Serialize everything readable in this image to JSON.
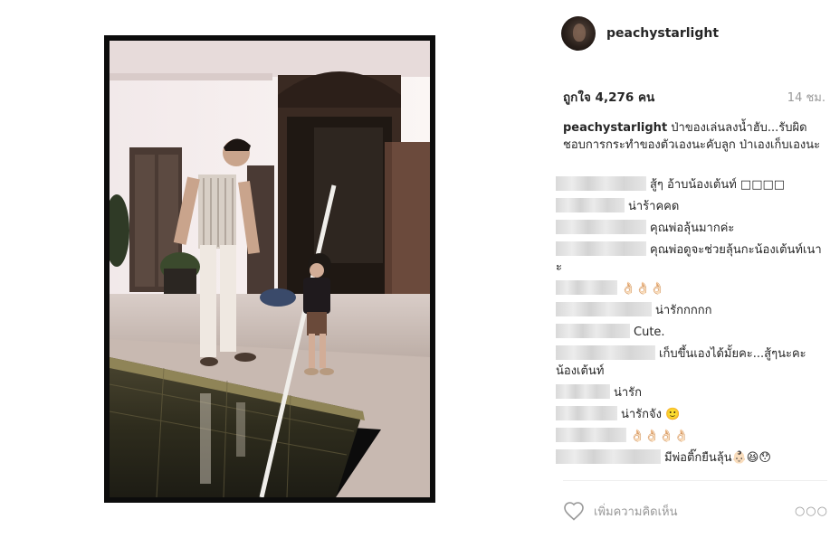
{
  "post": {
    "username": "peachystarlight",
    "likes": "ถูกใจ 4,276 คน",
    "time": "14 ชม.",
    "caption_user": "peachystarlight",
    "caption_text": "ป่าของเล่นลงน้ำฮับ...รับผิดชอบการกระทำของตัวเองนะคับลูก ป่าเองเก็บเองนะ"
  },
  "comments": [
    {
      "text": "สู้ๆ อ้าบน้องเต้นท์ □□□□",
      "blur_w": 100
    },
    {
      "text": "น่าร้าคคด",
      "blur_w": 76
    },
    {
      "text": "คุณพ่อลุ้นมากค่ะ",
      "blur_w": 100
    },
    {
      "text": "คุณพ่อดูจะช่วยลุ้นกะน้องเต้นท์เนาะ",
      "blur_w": 100
    },
    {
      "text": "👌🏻👌🏻👌🏻",
      "blur_w": 68
    },
    {
      "text": "น่ารักกกกก",
      "blur_w": 106
    },
    {
      "text": "Cute.",
      "blur_w": 82
    },
    {
      "text": "เก็บขึ้นเองได้มั้ยคะ...สู้ๆนะคะน้องเต้นท์",
      "blur_w": 110
    },
    {
      "text": "น่ารัก",
      "blur_w": 60
    },
    {
      "text": "น่ารักจัง 🙂",
      "blur_w": 68
    },
    {
      "text": "👌🏻👌🏻👌🏻👌🏻",
      "blur_w": 78
    },
    {
      "text": "มีพ่อติ๊กยืนลุ้น👶🏻😆😯",
      "blur_w": 116
    }
  ],
  "footer": {
    "add_comment_placeholder": "เพิ่มความคิดเห็น",
    "more_label": "○○○"
  },
  "icons": {
    "like": "heart-outline-icon",
    "more": "ellipsis-icon"
  }
}
